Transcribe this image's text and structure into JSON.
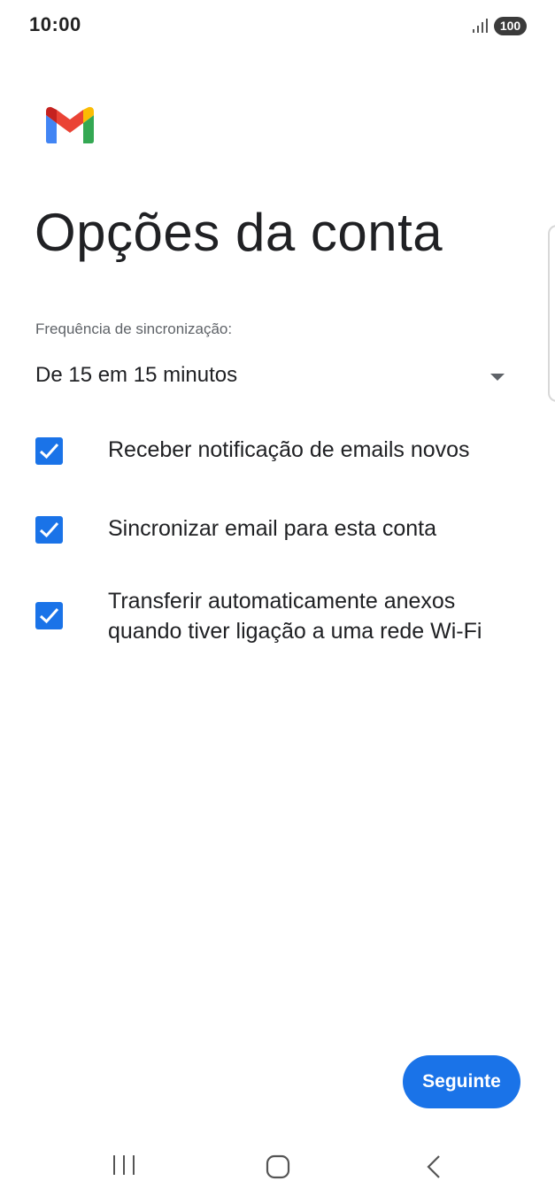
{
  "status_bar": {
    "time": "10:00",
    "signal_icon": "signal-bars-icon",
    "battery": "100"
  },
  "logo": {
    "icon": "gmail-logo",
    "colors": [
      "#EA4335",
      "#FBBC04",
      "#34A853",
      "#4285F4",
      "#C5221F"
    ]
  },
  "page": {
    "title": "Opções da conta"
  },
  "sync": {
    "label": "Frequência de sincronização:",
    "selected": "De 15 em 15 minutos"
  },
  "options": [
    {
      "label": "Receber notificação de emails novos",
      "checked": true
    },
    {
      "label": "Sincronizar email para esta conta",
      "checked": true
    },
    {
      "label_line1": "Transferir automaticamente anexos",
      "label_line2": "quando tiver ligação a uma rede Wi-Fi",
      "checked": true
    }
  ],
  "actions": {
    "next_label": "Seguinte"
  },
  "nav": {
    "recents_icon": "recents-icon",
    "home_icon": "home-icon",
    "back_icon": "back-icon"
  },
  "colors": {
    "accent": "#1a73e8",
    "text": "#202124",
    "secondary_text": "#5f6368"
  }
}
